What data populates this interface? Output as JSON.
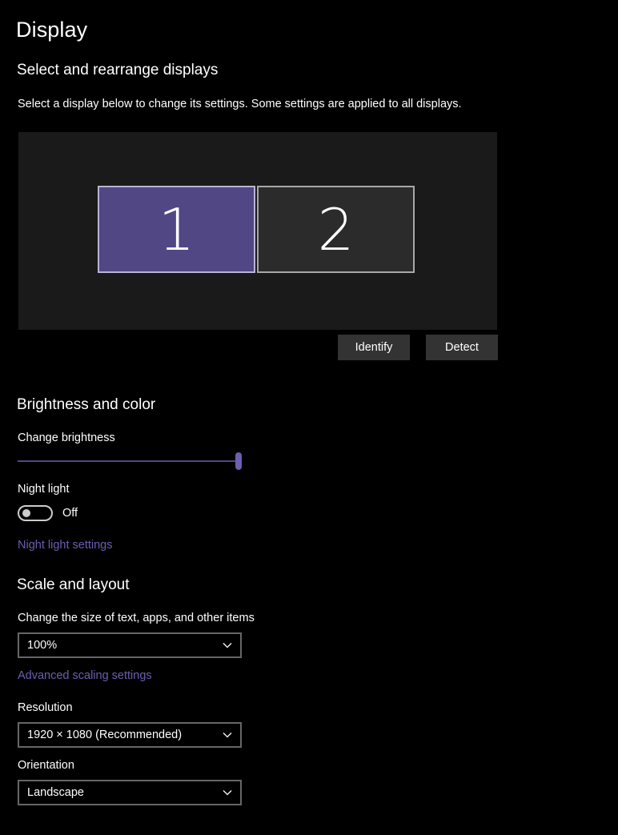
{
  "page": {
    "title": "Display"
  },
  "arrange": {
    "heading": "Select and rearrange displays",
    "description": "Select a display below to change its settings. Some settings are applied to all displays.",
    "displays": [
      {
        "label": "1",
        "selected": true,
        "color": "#524785"
      },
      {
        "label": "2",
        "selected": false,
        "color": "#2b2b2b"
      }
    ],
    "identify_label": "Identify",
    "detect_label": "Detect"
  },
  "brightness": {
    "heading": "Brightness and color",
    "change_brightness_label": "Change brightness",
    "brightness_value": 1.0,
    "night_light_label": "Night light",
    "night_light_state": "Off",
    "night_light_settings_link": "Night light settings"
  },
  "scale": {
    "heading": "Scale and layout",
    "size_label": "Change the size of text, apps, and other items",
    "size_value": "100%",
    "advanced_link": "Advanced scaling settings",
    "resolution_label": "Resolution",
    "resolution_value": "1920 × 1080 (Recommended)",
    "orientation_label": "Orientation",
    "orientation_value": "Landscape"
  },
  "colors": {
    "accent": "#6b5fb1",
    "selected_display": "#524785",
    "background": "#000000",
    "button_bg": "#333333"
  },
  "icons": {
    "dropdown": "chevron-down-icon"
  }
}
